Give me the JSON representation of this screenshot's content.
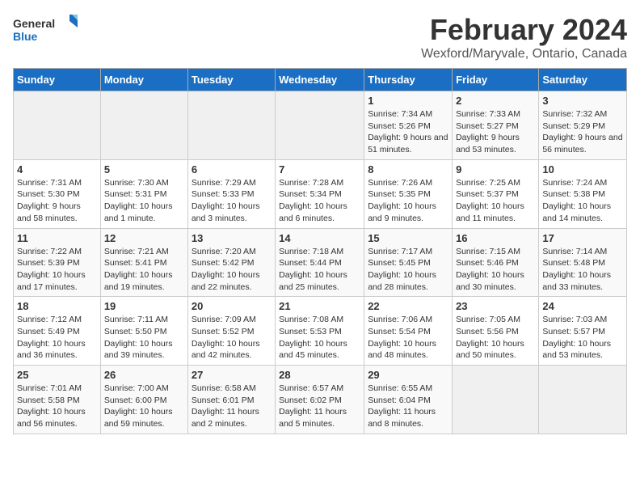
{
  "logo": {
    "line1": "General",
    "line2": "Blue"
  },
  "title": "February 2024",
  "subtitle": "Wexford/Maryvale, Ontario, Canada",
  "weekdays": [
    "Sunday",
    "Monday",
    "Tuesday",
    "Wednesday",
    "Thursday",
    "Friday",
    "Saturday"
  ],
  "weeks": [
    [
      {
        "day": "",
        "info": ""
      },
      {
        "day": "",
        "info": ""
      },
      {
        "day": "",
        "info": ""
      },
      {
        "day": "",
        "info": ""
      },
      {
        "day": "1",
        "info": "Sunrise: 7:34 AM\nSunset: 5:26 PM\nDaylight: 9 hours and 51 minutes."
      },
      {
        "day": "2",
        "info": "Sunrise: 7:33 AM\nSunset: 5:27 PM\nDaylight: 9 hours and 53 minutes."
      },
      {
        "day": "3",
        "info": "Sunrise: 7:32 AM\nSunset: 5:29 PM\nDaylight: 9 hours and 56 minutes."
      }
    ],
    [
      {
        "day": "4",
        "info": "Sunrise: 7:31 AM\nSunset: 5:30 PM\nDaylight: 9 hours and 58 minutes."
      },
      {
        "day": "5",
        "info": "Sunrise: 7:30 AM\nSunset: 5:31 PM\nDaylight: 10 hours and 1 minute."
      },
      {
        "day": "6",
        "info": "Sunrise: 7:29 AM\nSunset: 5:33 PM\nDaylight: 10 hours and 3 minutes."
      },
      {
        "day": "7",
        "info": "Sunrise: 7:28 AM\nSunset: 5:34 PM\nDaylight: 10 hours and 6 minutes."
      },
      {
        "day": "8",
        "info": "Sunrise: 7:26 AM\nSunset: 5:35 PM\nDaylight: 10 hours and 9 minutes."
      },
      {
        "day": "9",
        "info": "Sunrise: 7:25 AM\nSunset: 5:37 PM\nDaylight: 10 hours and 11 minutes."
      },
      {
        "day": "10",
        "info": "Sunrise: 7:24 AM\nSunset: 5:38 PM\nDaylight: 10 hours and 14 minutes."
      }
    ],
    [
      {
        "day": "11",
        "info": "Sunrise: 7:22 AM\nSunset: 5:39 PM\nDaylight: 10 hours and 17 minutes."
      },
      {
        "day": "12",
        "info": "Sunrise: 7:21 AM\nSunset: 5:41 PM\nDaylight: 10 hours and 19 minutes."
      },
      {
        "day": "13",
        "info": "Sunrise: 7:20 AM\nSunset: 5:42 PM\nDaylight: 10 hours and 22 minutes."
      },
      {
        "day": "14",
        "info": "Sunrise: 7:18 AM\nSunset: 5:44 PM\nDaylight: 10 hours and 25 minutes."
      },
      {
        "day": "15",
        "info": "Sunrise: 7:17 AM\nSunset: 5:45 PM\nDaylight: 10 hours and 28 minutes."
      },
      {
        "day": "16",
        "info": "Sunrise: 7:15 AM\nSunset: 5:46 PM\nDaylight: 10 hours and 30 minutes."
      },
      {
        "day": "17",
        "info": "Sunrise: 7:14 AM\nSunset: 5:48 PM\nDaylight: 10 hours and 33 minutes."
      }
    ],
    [
      {
        "day": "18",
        "info": "Sunrise: 7:12 AM\nSunset: 5:49 PM\nDaylight: 10 hours and 36 minutes."
      },
      {
        "day": "19",
        "info": "Sunrise: 7:11 AM\nSunset: 5:50 PM\nDaylight: 10 hours and 39 minutes."
      },
      {
        "day": "20",
        "info": "Sunrise: 7:09 AM\nSunset: 5:52 PM\nDaylight: 10 hours and 42 minutes."
      },
      {
        "day": "21",
        "info": "Sunrise: 7:08 AM\nSunset: 5:53 PM\nDaylight: 10 hours and 45 minutes."
      },
      {
        "day": "22",
        "info": "Sunrise: 7:06 AM\nSunset: 5:54 PM\nDaylight: 10 hours and 48 minutes."
      },
      {
        "day": "23",
        "info": "Sunrise: 7:05 AM\nSunset: 5:56 PM\nDaylight: 10 hours and 50 minutes."
      },
      {
        "day": "24",
        "info": "Sunrise: 7:03 AM\nSunset: 5:57 PM\nDaylight: 10 hours and 53 minutes."
      }
    ],
    [
      {
        "day": "25",
        "info": "Sunrise: 7:01 AM\nSunset: 5:58 PM\nDaylight: 10 hours and 56 minutes."
      },
      {
        "day": "26",
        "info": "Sunrise: 7:00 AM\nSunset: 6:00 PM\nDaylight: 10 hours and 59 minutes."
      },
      {
        "day": "27",
        "info": "Sunrise: 6:58 AM\nSunset: 6:01 PM\nDaylight: 11 hours and 2 minutes."
      },
      {
        "day": "28",
        "info": "Sunrise: 6:57 AM\nSunset: 6:02 PM\nDaylight: 11 hours and 5 minutes."
      },
      {
        "day": "29",
        "info": "Sunrise: 6:55 AM\nSunset: 6:04 PM\nDaylight: 11 hours and 8 minutes."
      },
      {
        "day": "",
        "info": ""
      },
      {
        "day": "",
        "info": ""
      }
    ]
  ]
}
